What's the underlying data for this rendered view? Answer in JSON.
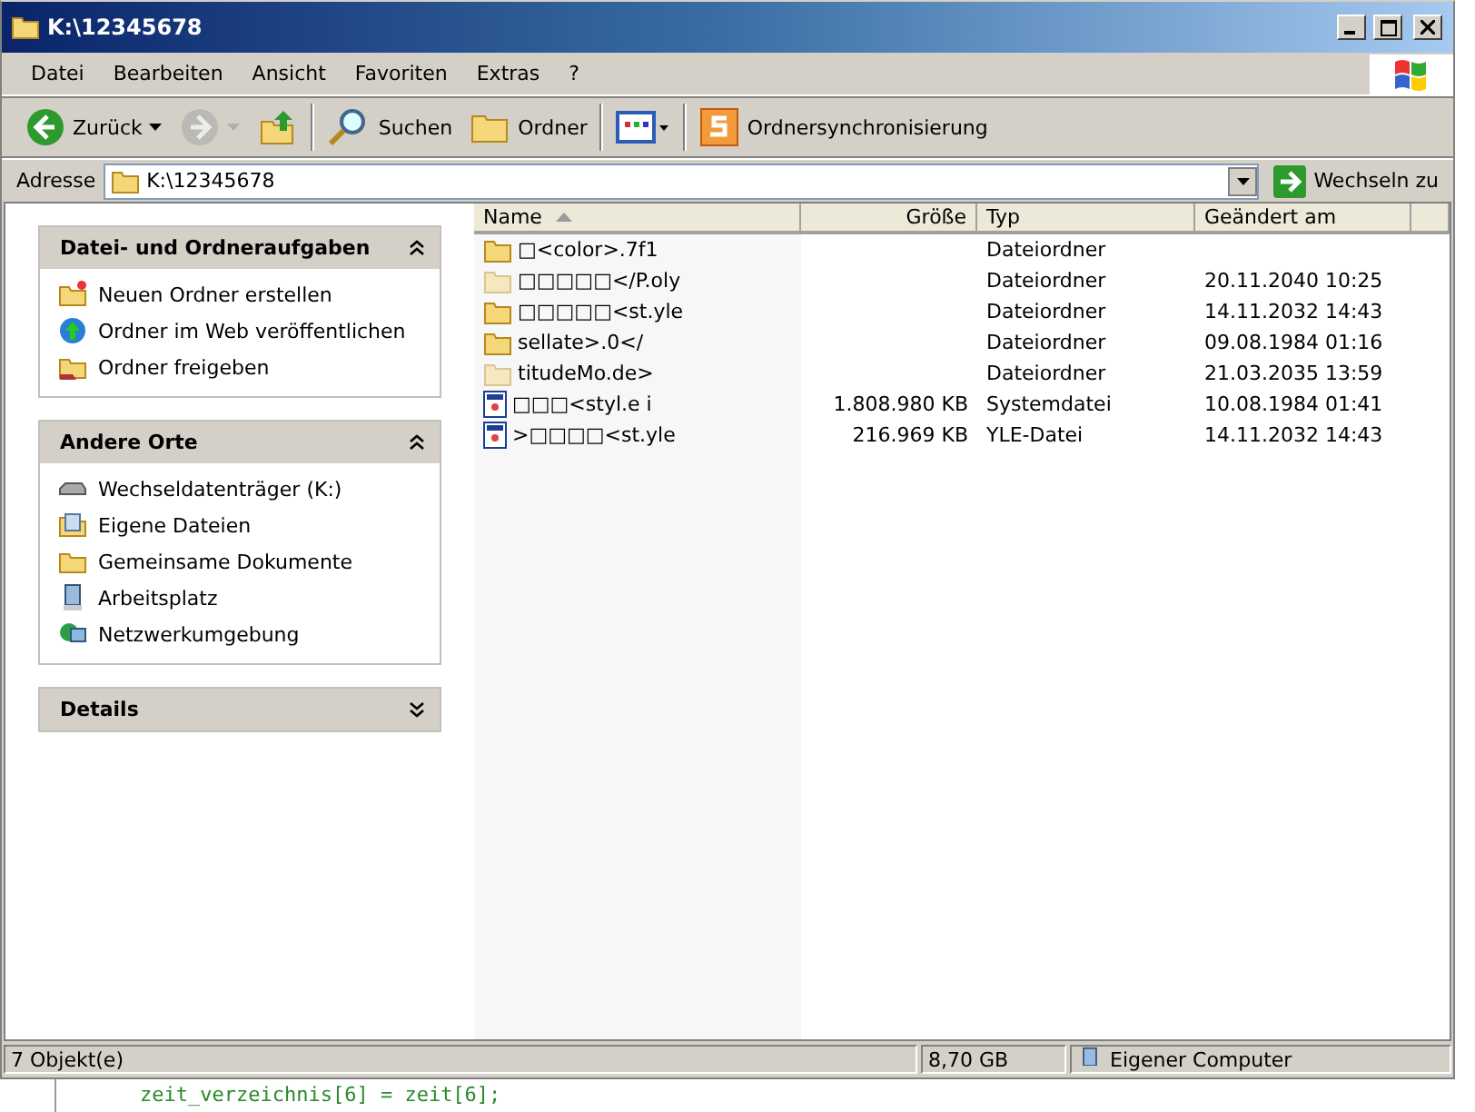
{
  "window": {
    "title": "K:\\12345678"
  },
  "menu": [
    "Datei",
    "Bearbeiten",
    "Ansicht",
    "Favoriten",
    "Extras",
    "?"
  ],
  "toolbar": [
    {
      "kind": "back",
      "label": "Zurück",
      "disabled": false
    },
    {
      "kind": "forward",
      "disabled": true
    },
    {
      "kind": "up"
    },
    {
      "kind": "search",
      "label": "Suchen"
    },
    {
      "kind": "folders",
      "label": "Ordner"
    },
    {
      "kind": "views"
    },
    {
      "kind": "sync",
      "label": "Ordnersynchronisierung"
    }
  ],
  "address": {
    "label": "Adresse",
    "value": "K:\\12345678",
    "go": "Wechseln zu"
  },
  "sidebar": [
    {
      "title": "Datei- und Ordneraufgaben",
      "expanded": true,
      "items": [
        {
          "label": "Neuen Ordner erstellen"
        },
        {
          "label": "Ordner im Web veröffentlichen"
        },
        {
          "label": "Ordner freigeben"
        }
      ]
    },
    {
      "title": "Andere Orte",
      "expanded": true,
      "items": [
        {
          "label": "Wechseldatenträger (K:)"
        },
        {
          "label": "Eigene Dateien"
        },
        {
          "label": "Gemeinsame Dokumente"
        },
        {
          "label": "Arbeitsplatz"
        },
        {
          "label": "Netzwerkumgebung"
        }
      ]
    },
    {
      "title": "Details",
      "expanded": false
    }
  ],
  "table": {
    "columns": [
      "Name",
      "Größe",
      "Typ",
      "Geändert am"
    ],
    "rows": [
      {
        "kind": "folder",
        "hidden": false,
        "name": "□<color>.7f1",
        "size": "",
        "type": "Dateiordner",
        "modified": ""
      },
      {
        "kind": "folder",
        "hidden": true,
        "name": "□□□□□</P.oly",
        "size": "",
        "type": "Dateiordner",
        "modified": "20.11.2040 10:25"
      },
      {
        "kind": "folder",
        "hidden": false,
        "name": "□□□□□<st.yle",
        "size": "",
        "type": "Dateiordner",
        "modified": "14.11.2032 14:43"
      },
      {
        "kind": "folder",
        "hidden": false,
        "name": "sellate>.0</",
        "size": "",
        "type": "Dateiordner",
        "modified": "09.08.1984 01:16"
      },
      {
        "kind": "folder",
        "hidden": true,
        "name": "titudeMo.de>",
        "size": "",
        "type": "Dateiordner",
        "modified": "21.03.2035 13:59"
      },
      {
        "kind": "file",
        "hidden": false,
        "name": "□□□<styl.e i",
        "size": "1.808.980 KB",
        "type": "Systemdatei",
        "modified": "10.08.1984 01:41"
      },
      {
        "kind": "file",
        "hidden": false,
        "name": ">□□□□<st.yle",
        "size": "216.969 KB",
        "type": "YLE-Datei",
        "modified": "14.11.2032 14:43"
      }
    ]
  },
  "status_bar": {
    "objects": "7 Objekt(e)",
    "size": "8,70 GB",
    "zone": "Eigener Computer"
  },
  "background": {
    "code_line": "zeit_verzeichnis[6] = zeit[6];"
  }
}
